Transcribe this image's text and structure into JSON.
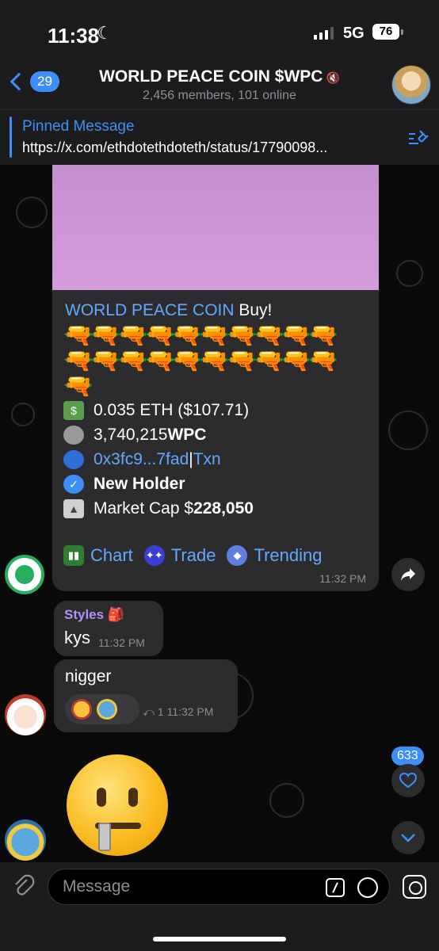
{
  "status": {
    "time": "11:38",
    "network": "5G",
    "battery": "76"
  },
  "header": {
    "back_count": "29",
    "title": "WORLD PEACE COIN $WPC",
    "subtitle": "2,456 members, 101 online"
  },
  "pinned": {
    "title": "Pinned Message",
    "text": "https://x.com/ethdotethdoteth/status/17790098..."
  },
  "bot_message": {
    "brand": "WORLD PEACE COIN",
    "buy_word": " Buy!",
    "guns": "🔫🔫🔫🔫🔫🔫🔫🔫🔫🔫🔫🔫🔫🔫🔫🔫🔫🔫🔫🔫🔫",
    "amount": "0.035 ETH ($107.71)",
    "tokens_value": "3,740,215 ",
    "tokens_symbol": "WPC",
    "address": "0x3fc9...7fad",
    "separator": " | ",
    "txn": "Txn",
    "new_holder": "New Holder",
    "market_cap_label": "Market Cap $",
    "market_cap_value": "228,050",
    "buttons": [
      "Chart",
      "Trade",
      "Trending"
    ],
    "time": "11:32 PM"
  },
  "messages": [
    {
      "sender": "Styles 🎒",
      "text": "kys",
      "time": "11:32 PM"
    },
    {
      "text": "nigger",
      "reply_count": "1",
      "time": "11:32 PM"
    }
  ],
  "unread_count": "633",
  "input": {
    "placeholder": "Message"
  },
  "colors": {
    "accent": "#3e8ef7",
    "link": "#63a8ff",
    "bubble": "#2c2c2e",
    "sender": "#b690f5"
  }
}
